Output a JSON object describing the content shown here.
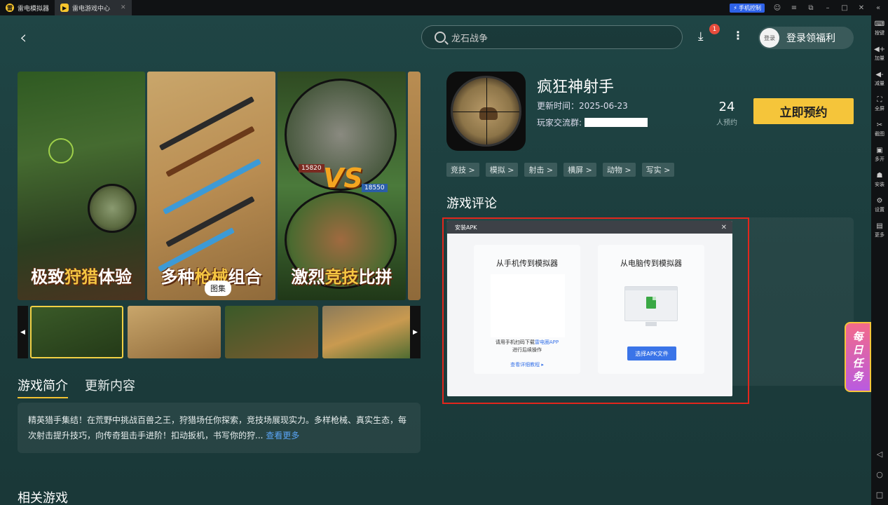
{
  "titlebar": {
    "tabs": [
      {
        "label": "雷电模拟器",
        "logo": "雷"
      },
      {
        "label": "雷电游戏中心",
        "logo": "▶"
      }
    ],
    "phone_control": "手机控制"
  },
  "sidebar": {
    "items": [
      {
        "label": "按键",
        "icon": "keyboard-icon"
      },
      {
        "label": "加量",
        "icon": "volume-up-icon"
      },
      {
        "label": "减量",
        "icon": "volume-down-icon"
      },
      {
        "label": "全屏",
        "icon": "fullscreen-icon"
      },
      {
        "label": "截图",
        "icon": "scissors-icon"
      },
      {
        "label": "多开",
        "icon": "multi-instance-icon"
      },
      {
        "label": "安装",
        "icon": "android-icon"
      },
      {
        "label": "设置",
        "icon": "gear-icon"
      },
      {
        "label": "更多",
        "icon": "more-icon"
      }
    ]
  },
  "header": {
    "search_placeholder": "龙石战争",
    "download_badge": "1",
    "avatar_label": "登录",
    "login_label": "登录领福利"
  },
  "gallery": {
    "captions": [
      {
        "pre": "极致",
        "hl": "狩猎",
        "post": "体验"
      },
      {
        "pre": "多种",
        "hl": "枪械",
        "post": "组合"
      },
      {
        "pre": "激烈",
        "hl": "竞技",
        "post": "比拼"
      }
    ],
    "vs_text": "VS",
    "scores": [
      "15820",
      "18550"
    ],
    "pill": "图集"
  },
  "game": {
    "name": "疯狂神射手",
    "update_time": "更新时间：2025-06-23",
    "group_label": "玩家交流群:",
    "reserve_count": "24",
    "reserve_label": "人预约",
    "reserve_button": "立即预约",
    "tags": [
      "竞技 >",
      "模拟 >",
      "射击 >",
      "横屏 >",
      "动物 >",
      "写实 >"
    ]
  },
  "intro": {
    "tabs": [
      "游戏简介",
      "更新内容"
    ],
    "text": "精英猎手集结！在荒野中挑战百兽之王，狩猎场任你探索，竞技场展现实力。多样枪械、真实生态，每次射击提升技巧，向传奇狙击手进阶！扣动扳机，书写你的狩...",
    "see_more": "查看更多"
  },
  "reviews_title": "游戏评论",
  "related_title": "相关游戏",
  "daily_task": [
    "每",
    "日",
    "任",
    "务"
  ],
  "dialog": {
    "title": "安装APK",
    "left_title": "从手机传到模拟器",
    "qr_text_pre": "请用手机扫码下载",
    "qr_text_link": "雷电圈APP",
    "qr_text_post": "进行后续操作",
    "tutorial": "查看详细教程",
    "right_title": "从电脑传到模拟器",
    "choose_button": "选择APK文件"
  },
  "colors": {
    "accent_yellow": "#f5c53a",
    "link_blue": "#3a74e8",
    "highlight_red": "#e2261c"
  }
}
